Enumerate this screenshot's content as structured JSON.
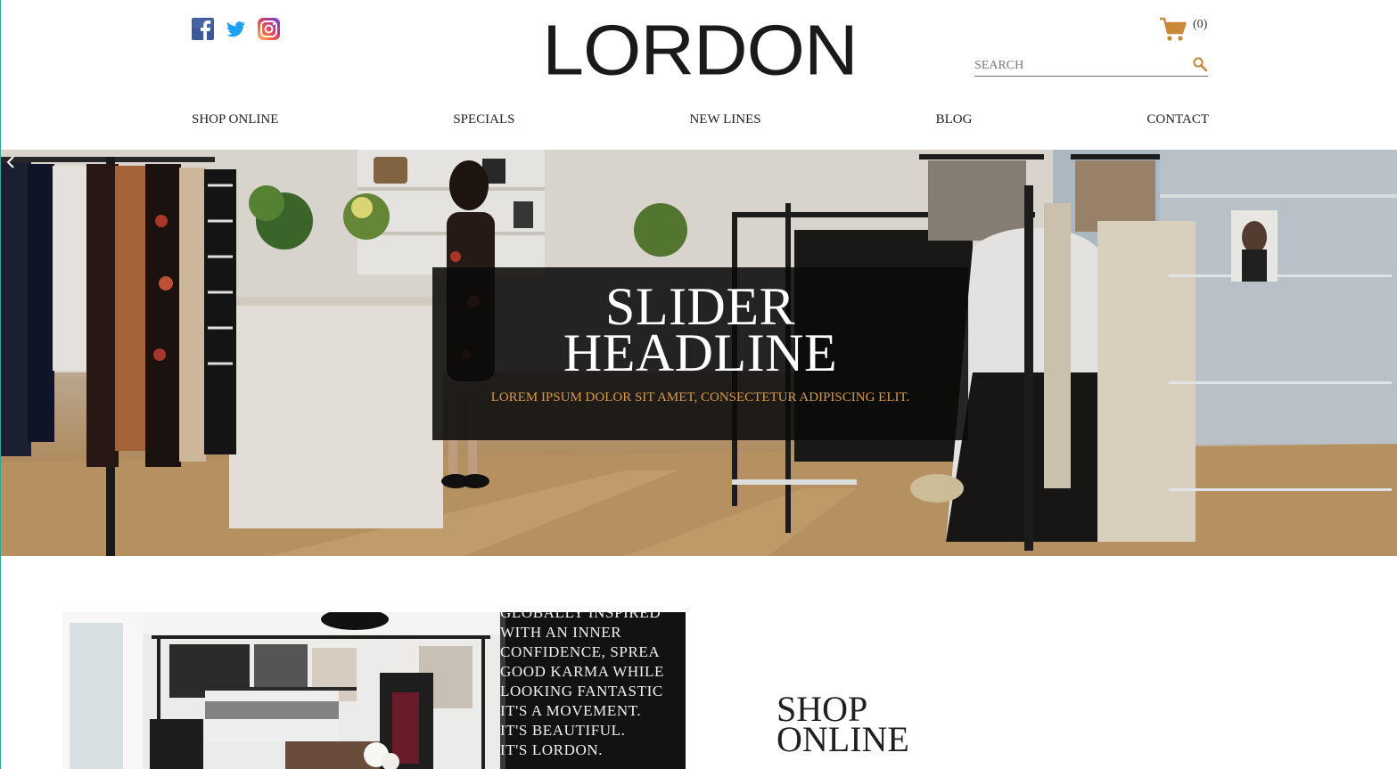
{
  "brand": {
    "logo_text": "LORDON"
  },
  "social": {
    "items": [
      "facebook-icon",
      "twitter-icon",
      "instagram-icon"
    ],
    "colors": {
      "facebook": "#3b5998",
      "twitter": "#1da1f2",
      "instagram": "#c13584"
    }
  },
  "cart": {
    "count_text": "(0)",
    "icon": "cart-icon",
    "color": "#c8893a"
  },
  "search": {
    "placeholder": "SEARCH",
    "icon": "magnifier-icon"
  },
  "nav": {
    "items": [
      {
        "label": "SHOP ONLINE"
      },
      {
        "label": "SPECIALS"
      },
      {
        "label": "NEW LINES"
      },
      {
        "label": "BLOG"
      },
      {
        "label": "CONTACT"
      }
    ]
  },
  "hero": {
    "title_line1": "SLIDER",
    "title_line2": "HEADLINE",
    "subtitle": "LOREM IPSUM DOLOR SIT AMET, CONSECTETUR ADIPISCING ELIT.",
    "subtitle_color": "#d89a48",
    "prev_icon": "chevron-left-icon"
  },
  "promo": {
    "chalkboard_lines": [
      "GLOBALLY INSPIRED",
      "WITH AN INNER",
      "CONFIDENCE, SPREA",
      "GOOD KARMA WHILE",
      "LOOKING FANTASTIC",
      "IT'S A MOVEMENT.",
      "IT'S BEAUTIFUL.",
      "IT'S LORDON."
    ]
  },
  "shop_section": {
    "heading_line1": "SHOP",
    "heading_line2": "ONLINE"
  }
}
